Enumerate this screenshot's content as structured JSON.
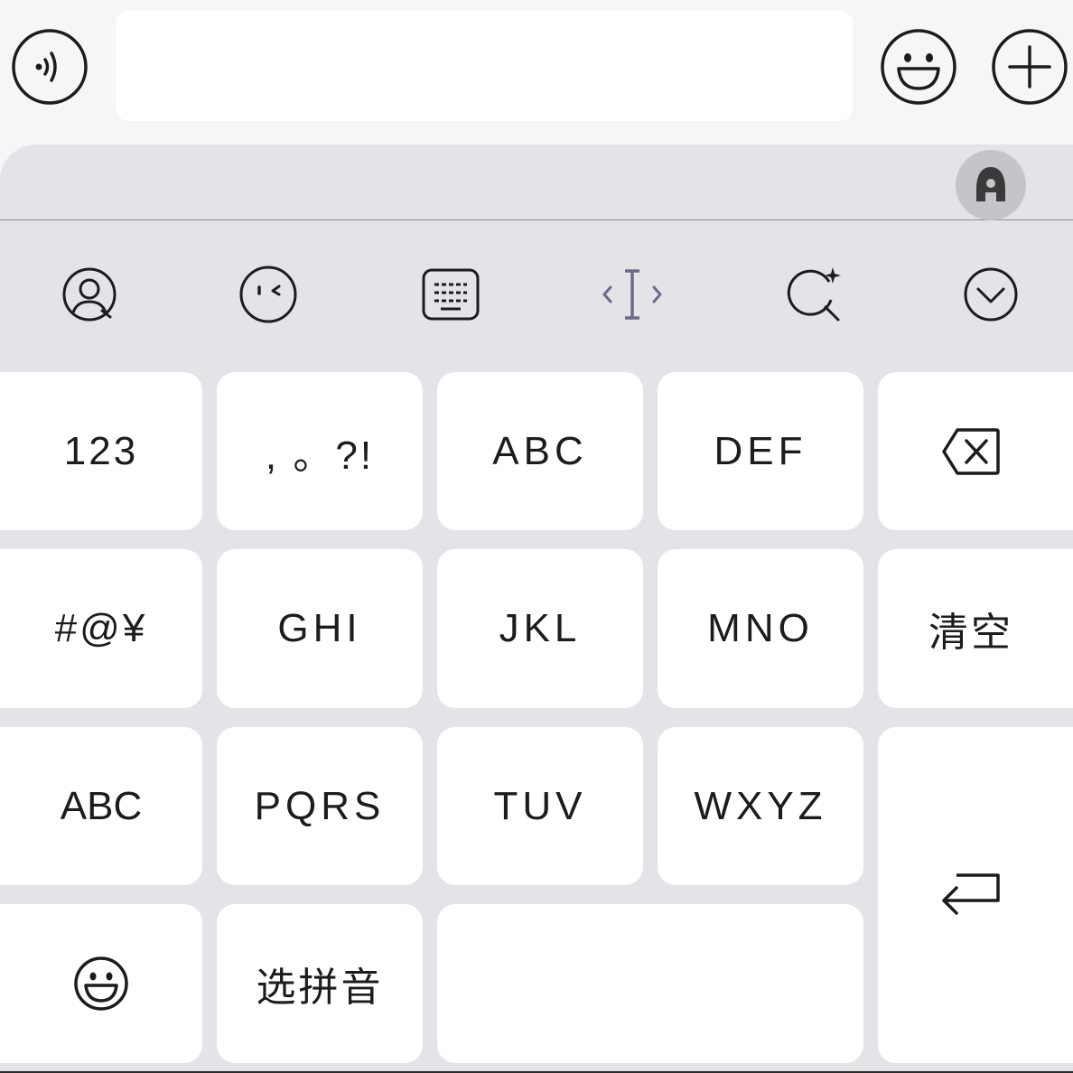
{
  "input_bar": {
    "text_value": "",
    "voice_icon": "voice-icon",
    "emoji_icon": "smile-icon",
    "plus_icon": "plus-icon"
  },
  "keyboard": {
    "ai_icon": "ai-assistant-icon",
    "toolbar": [
      {
        "icon": "user-profile-icon"
      },
      {
        "icon": "emoticon-wink-icon"
      },
      {
        "icon": "keyboard-icon"
      },
      {
        "icon": "cursor-move-icon"
      },
      {
        "icon": "sparkle-search-icon"
      },
      {
        "icon": "collapse-chevron-icon"
      }
    ],
    "keys": {
      "num": "123",
      "punct": ", 。?!",
      "abc": "ABC",
      "def": "DEF",
      "symbols": "#@¥",
      "ghi": "GHI",
      "jkl": "JKL",
      "mno": "MNO",
      "clear": "清空",
      "abc_switch": "ABC",
      "pqrs": "PQRS",
      "tuv": "TUV",
      "wxyz": "WXYZ",
      "pinyin": "选拼音",
      "space": ""
    },
    "icons": {
      "backspace": "backspace-icon",
      "return": "return-icon",
      "emoji": "emoji-icon"
    }
  },
  "colors": {
    "keyboard_bg": "#e3e3e8",
    "key_bg": "#ffffff",
    "text": "#1c1c1e",
    "input_bar_bg": "#f6f6f7"
  }
}
